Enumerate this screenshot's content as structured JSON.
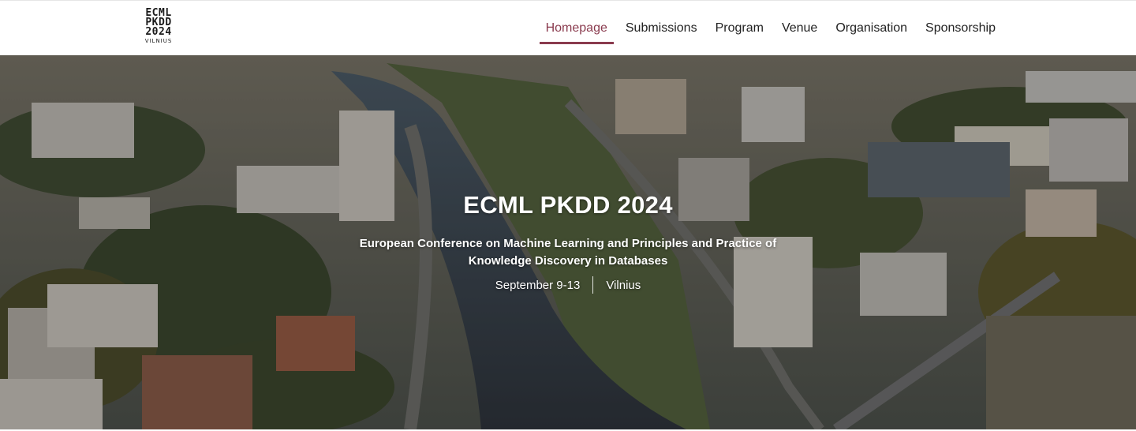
{
  "header": {
    "logo": {
      "line1": "ECML",
      "line2": "PKDD",
      "line3": "2024",
      "line4": "VILNIUS"
    },
    "nav": [
      {
        "label": "Homepage",
        "active": true
      },
      {
        "label": "Submissions",
        "active": false
      },
      {
        "label": "Program",
        "active": false
      },
      {
        "label": "Venue",
        "active": false
      },
      {
        "label": "Organisation",
        "active": false
      },
      {
        "label": "Sponsorship",
        "active": false
      }
    ]
  },
  "hero": {
    "title": "ECML PKDD 2024",
    "subtitle": "European Conference on Machine Learning and Principles and Practice of Knowledge Discovery in Databases",
    "dates": "September 9-13",
    "location": "Vilnius"
  },
  "colors": {
    "accent": "#8a3b4e",
    "nav_text": "#222222",
    "hero_text": "#ffffff"
  }
}
